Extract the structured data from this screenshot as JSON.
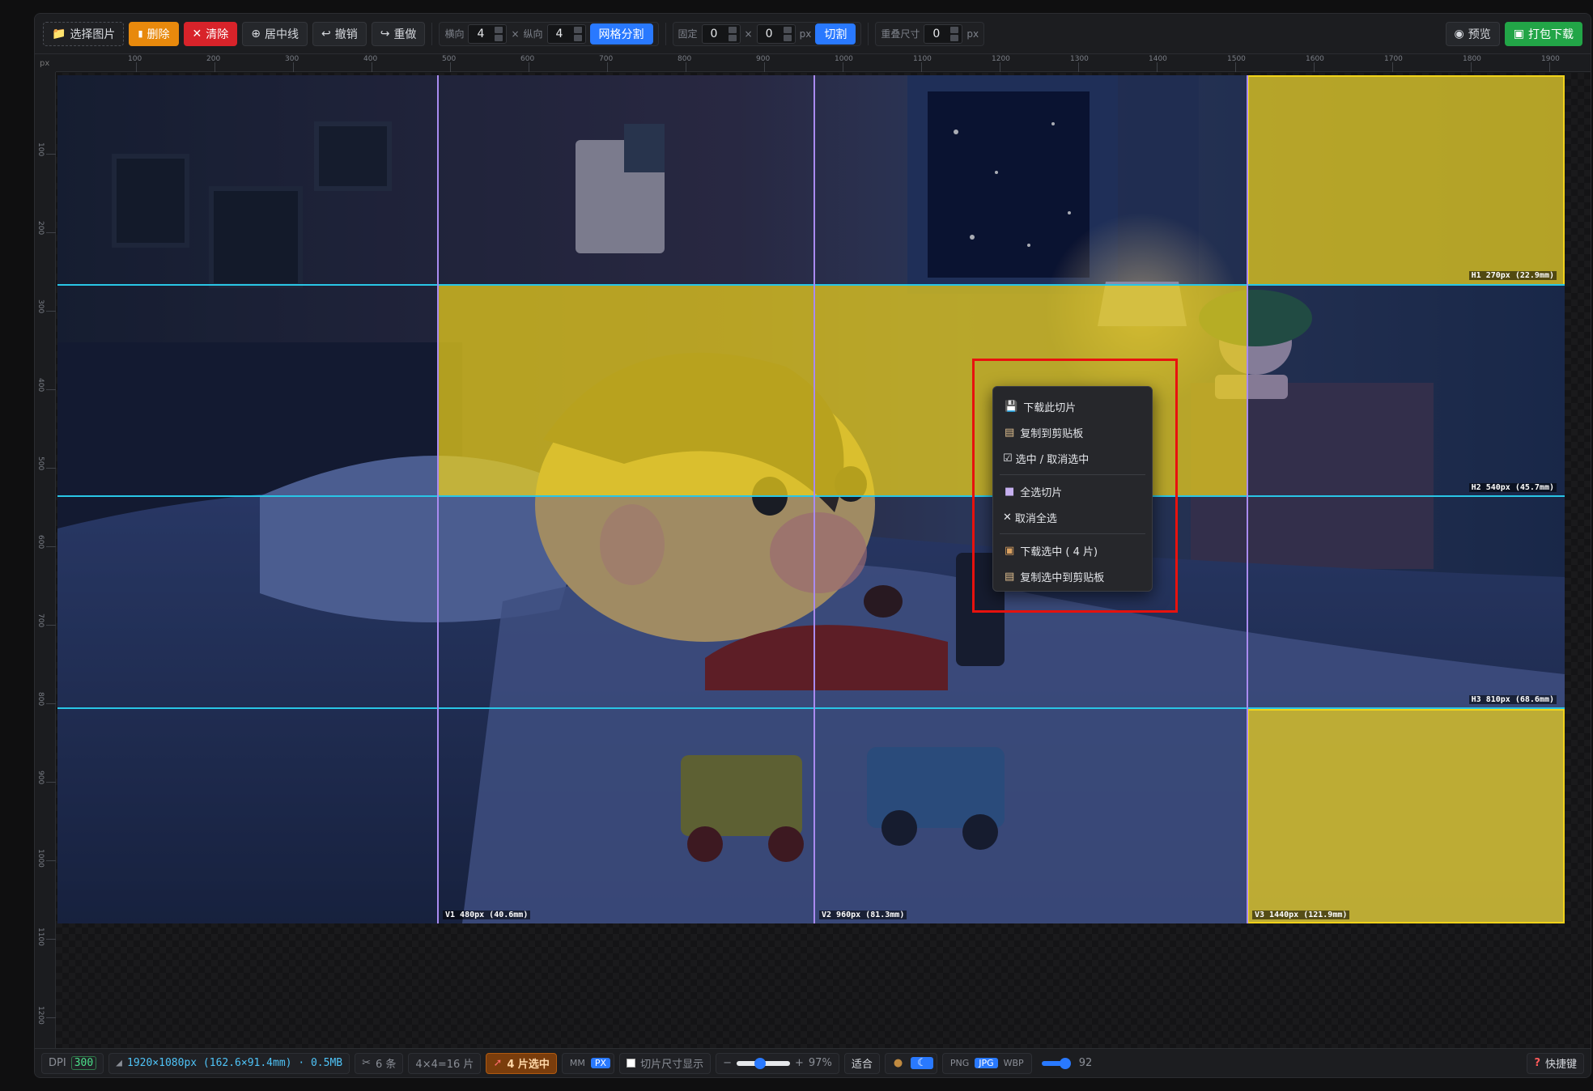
{
  "toolbar": {
    "select_image": "选择图片",
    "delete": "删除",
    "clear": "清除",
    "center_line": "居中线",
    "undo": "撤销",
    "redo": "重做",
    "horizontal_label": "横向",
    "horizontal_value": "4",
    "times": "×",
    "vertical_label": "纵向",
    "vertical_value": "4",
    "grid_split": "网格分割",
    "fixed_label": "固定",
    "fixed_w": "0",
    "fixed_h": "0",
    "px_unit": "px",
    "cut": "切割",
    "overlap_label": "重叠尺寸",
    "overlap_value": "0",
    "preview": "预览",
    "pack_download": "打包下载"
  },
  "ruler": {
    "unit": "px",
    "top_ticks": [
      "100",
      "200",
      "300",
      "400",
      "500",
      "600",
      "700",
      "800",
      "900",
      "1000",
      "1100",
      "1200",
      "1300",
      "1400",
      "1500",
      "1600",
      "1700",
      "1800",
      "1900"
    ],
    "left_ticks": [
      "100",
      "200",
      "300",
      "400",
      "500",
      "600",
      "700",
      "800",
      "900",
      "1000",
      "1100",
      "1200"
    ]
  },
  "guides": {
    "h1": "H1 270px (22.9mm)",
    "h2": "H2 540px (45.7mm)",
    "h3": "H3 810px (68.6mm)",
    "v1": "V1 480px (40.6mm)",
    "v2": "V2 960px (81.3mm)",
    "v3": "V3 1440px (121.9mm)"
  },
  "context_menu": {
    "download_slice": "下载此切片",
    "copy_clipboard": "复制到剪贴板",
    "toggle_select": "选中 / 取消选中",
    "select_all": "全选切片",
    "deselect_all": "取消全选",
    "download_selected": "下载选中 ( 4 片)",
    "copy_selected": "复制选中到剪贴板"
  },
  "status": {
    "dpi_label": "DPI",
    "dpi_value": "300",
    "image_info": "1920×1080px (162.6×91.4mm) · 0.5MB",
    "lines": "6 条",
    "grid_count": "4×4=16 片",
    "selected": "4 片选中",
    "mm": "MM",
    "px": "PX",
    "show_size": "切片尺寸显示",
    "minus": "−",
    "plus": "+",
    "zoom": "97%",
    "fit": "适合",
    "png": "PNG",
    "jpg": "JPG",
    "webp": "WBP",
    "quality": "92",
    "shortcuts": "快捷键"
  },
  "colors": {
    "accent_blue": "#2979ff",
    "delete_orange": "#e8890c",
    "clear_red": "#d8232a",
    "download_green": "#22a547",
    "guide_cyan": "#29c6e6",
    "guide_purple": "#a98bf0",
    "selection_yellow": "#f0d21a"
  }
}
